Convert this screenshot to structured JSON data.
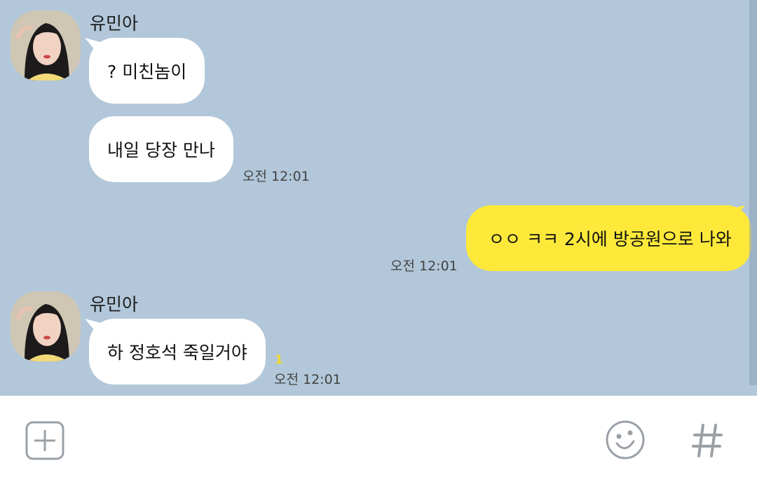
{
  "messages": [
    {
      "sender": "유민아",
      "text": "? 미친놈이"
    },
    {
      "text": "내일 당장 만나",
      "time": "오전 12:01"
    },
    {
      "text": "ㅇㅇ ㅋㅋ 2시에 방공원으로 나와",
      "time": "오전 12:01"
    },
    {
      "sender": "유민아",
      "text": "하 정호석 죽일거야",
      "unread": "1",
      "time": "오전 12:01"
    }
  ],
  "colors": {
    "background": "#b2c7d9",
    "incoming_bubble": "#ffffff",
    "outgoing_bubble": "#fee93a",
    "unread": "#f0da2a",
    "icon": "#9aa0a6"
  },
  "input_bar": {
    "icons": [
      "plus-square-icon",
      "emoji-icon",
      "hashtag-icon"
    ]
  }
}
